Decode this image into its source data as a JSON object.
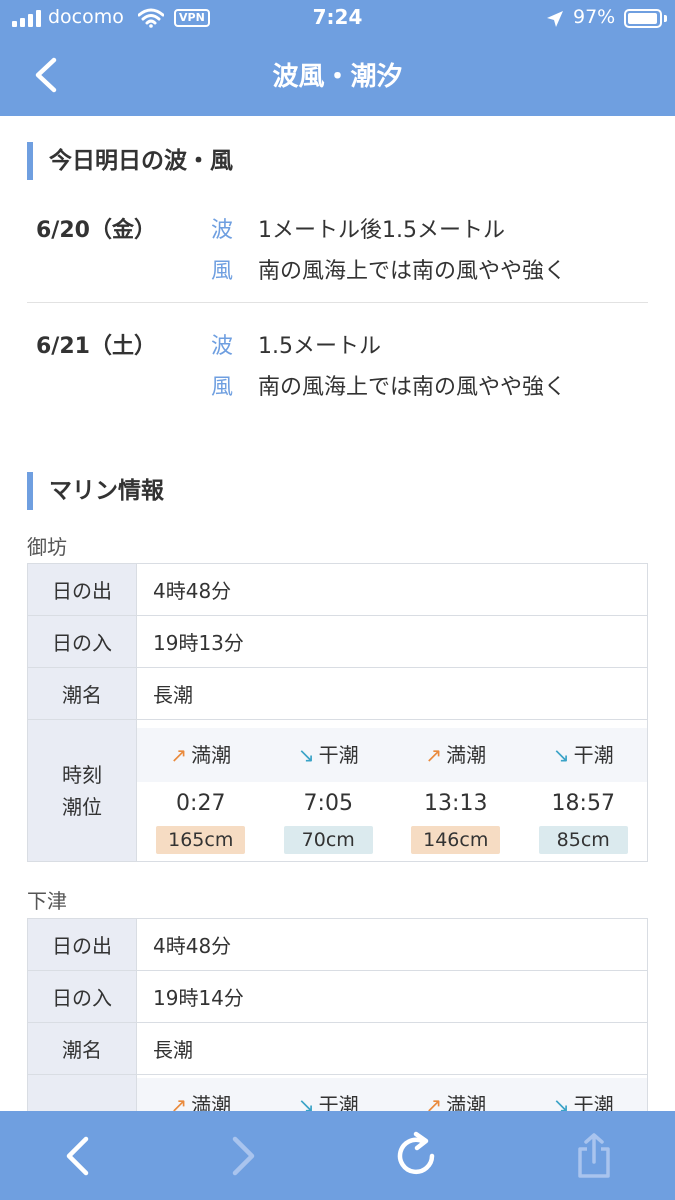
{
  "status": {
    "carrier": "docomo",
    "vpn": "VPN",
    "time": "7:24",
    "battery": "97%",
    "battery_level": 0.97
  },
  "header": {
    "title": "波風・潮汐"
  },
  "waves_section": {
    "title": "今日明日の波・風",
    "days": [
      {
        "date": "6/20（金）",
        "wave_label": "波",
        "wave": "1メートル後1.5メートル",
        "wind_label": "風",
        "wind": "南の風海上では南の風やや強く"
      },
      {
        "date": "6/21（土）",
        "wave_label": "波",
        "wave": "1.5メートル",
        "wind_label": "風",
        "wind": "南の風海上では南の風やや強く"
      }
    ]
  },
  "marine_section": {
    "title": "マリン情報",
    "locations": [
      {
        "name": "御坊",
        "sunrise_label": "日の出",
        "sunrise": "4時48分",
        "sunset_label": "日の入",
        "sunset": "19時13分",
        "tide_name_label": "潮名",
        "tide_name": "長潮",
        "tide_label": "時刻\n潮位",
        "tides": [
          {
            "type": "満潮",
            "arrow": "↗",
            "time": "0:27",
            "level": "165cm"
          },
          {
            "type": "干潮",
            "arrow": "↘",
            "time": "7:05",
            "level": "70cm"
          },
          {
            "type": "満潮",
            "arrow": "↗",
            "time": "13:13",
            "level": "146cm"
          },
          {
            "type": "干潮",
            "arrow": "↘",
            "time": "18:57",
            "level": "85cm"
          }
        ]
      },
      {
        "name": "下津",
        "sunrise_label": "日の出",
        "sunrise": "4時48分",
        "sunset_label": "日の入",
        "sunset": "19時14分",
        "tide_name_label": "潮名",
        "tide_name": "長潮",
        "tides": [
          {
            "type": "満潮",
            "arrow": "↗"
          },
          {
            "type": "干潮",
            "arrow": "↘"
          },
          {
            "type": "満潮",
            "arrow": "↗"
          },
          {
            "type": "干潮",
            "arrow": "↘"
          }
        ]
      }
    ]
  },
  "toolbar": {
    "icons": [
      "back-arrow-icon",
      "forward-arrow-icon",
      "reload-icon",
      "share-icon"
    ]
  },
  "colors": {
    "accent": "#6f9fe0",
    "high_tide": "#e98a3c",
    "low_tide": "#3aa3c7",
    "high_badge": "#f6dcc3",
    "low_badge": "#dbeaee"
  }
}
